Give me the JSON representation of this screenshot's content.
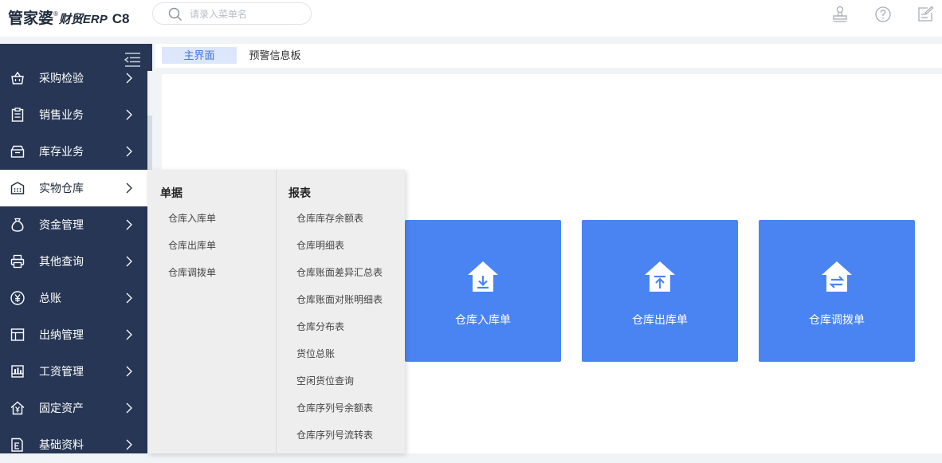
{
  "app": {
    "logo_main": "管家婆",
    "logo_reg": "®",
    "logo_sub": "财贸ERP",
    "logo_version": "C8"
  },
  "search": {
    "placeholder": "请录入菜单名"
  },
  "top_icons": [
    "stamp-icon",
    "help-icon",
    "edit-note-icon"
  ],
  "sidebar": {
    "items": [
      {
        "label": "采购检验",
        "icon": "basket-icon",
        "active": false
      },
      {
        "label": "销售业务",
        "icon": "clipboard-icon",
        "active": false
      },
      {
        "label": "库存业务",
        "icon": "archive-box-icon",
        "active": false
      },
      {
        "label": "实物仓库",
        "icon": "warehouse-icon",
        "active": true
      },
      {
        "label": "资金管理",
        "icon": "money-bag-icon",
        "active": false
      },
      {
        "label": "其他查询",
        "icon": "printer-icon",
        "active": false
      },
      {
        "label": "总账",
        "icon": "yen-circle-icon",
        "active": false
      },
      {
        "label": "出纳管理",
        "icon": "ledger-grid-icon",
        "active": false
      },
      {
        "label": "工资管理",
        "icon": "salary-chart-icon",
        "active": false
      },
      {
        "label": "固定资产",
        "icon": "house-yen-icon",
        "active": false
      },
      {
        "label": "基础资料",
        "icon": "document-e-icon",
        "active": false
      }
    ]
  },
  "tabs": [
    {
      "label": "主界面",
      "active": true
    },
    {
      "label": "预警信息板",
      "active": false
    }
  ],
  "flyout": {
    "col1": {
      "heading": "单据",
      "items": [
        "仓库入库单",
        "仓库出库单",
        "仓库调拨单"
      ]
    },
    "col2": {
      "heading": "报表",
      "items": [
        "仓库库存余额表",
        "仓库明细表",
        "仓库账面差异汇总表",
        "仓库账面对账明细表",
        "仓库分布表",
        "货位总账",
        "空闲货位查询",
        "仓库序列号余额表",
        "仓库序列号流转表"
      ]
    }
  },
  "cards": [
    {
      "label": "仓库入库单",
      "icon": "house-arrow-down-icon"
    },
    {
      "label": "仓库出库单",
      "icon": "house-arrow-up-icon"
    },
    {
      "label": "仓库调拨单",
      "icon": "house-transfer-icon"
    }
  ],
  "colors": {
    "sidebar_bg": "#263654",
    "accent": "#4a84f3",
    "tab_active_bg": "#dce7fb",
    "tab_active_text": "#3d73e0"
  }
}
